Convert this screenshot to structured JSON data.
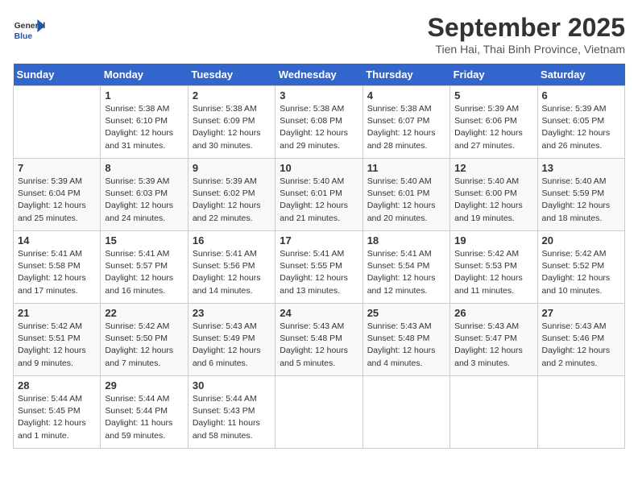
{
  "header": {
    "logo_line1": "General",
    "logo_line2": "Blue",
    "month": "September 2025",
    "location": "Tien Hai, Thai Binh Province, Vietnam"
  },
  "weekdays": [
    "Sunday",
    "Monday",
    "Tuesday",
    "Wednesday",
    "Thursday",
    "Friday",
    "Saturday"
  ],
  "weeks": [
    [
      {
        "day": "",
        "info": ""
      },
      {
        "day": "1",
        "info": "Sunrise: 5:38 AM\nSunset: 6:10 PM\nDaylight: 12 hours\nand 31 minutes."
      },
      {
        "day": "2",
        "info": "Sunrise: 5:38 AM\nSunset: 6:09 PM\nDaylight: 12 hours\nand 30 minutes."
      },
      {
        "day": "3",
        "info": "Sunrise: 5:38 AM\nSunset: 6:08 PM\nDaylight: 12 hours\nand 29 minutes."
      },
      {
        "day": "4",
        "info": "Sunrise: 5:38 AM\nSunset: 6:07 PM\nDaylight: 12 hours\nand 28 minutes."
      },
      {
        "day": "5",
        "info": "Sunrise: 5:39 AM\nSunset: 6:06 PM\nDaylight: 12 hours\nand 27 minutes."
      },
      {
        "day": "6",
        "info": "Sunrise: 5:39 AM\nSunset: 6:05 PM\nDaylight: 12 hours\nand 26 minutes."
      }
    ],
    [
      {
        "day": "7",
        "info": "Sunrise: 5:39 AM\nSunset: 6:04 PM\nDaylight: 12 hours\nand 25 minutes."
      },
      {
        "day": "8",
        "info": "Sunrise: 5:39 AM\nSunset: 6:03 PM\nDaylight: 12 hours\nand 24 minutes."
      },
      {
        "day": "9",
        "info": "Sunrise: 5:39 AM\nSunset: 6:02 PM\nDaylight: 12 hours\nand 22 minutes."
      },
      {
        "day": "10",
        "info": "Sunrise: 5:40 AM\nSunset: 6:01 PM\nDaylight: 12 hours\nand 21 minutes."
      },
      {
        "day": "11",
        "info": "Sunrise: 5:40 AM\nSunset: 6:01 PM\nDaylight: 12 hours\nand 20 minutes."
      },
      {
        "day": "12",
        "info": "Sunrise: 5:40 AM\nSunset: 6:00 PM\nDaylight: 12 hours\nand 19 minutes."
      },
      {
        "day": "13",
        "info": "Sunrise: 5:40 AM\nSunset: 5:59 PM\nDaylight: 12 hours\nand 18 minutes."
      }
    ],
    [
      {
        "day": "14",
        "info": "Sunrise: 5:41 AM\nSunset: 5:58 PM\nDaylight: 12 hours\nand 17 minutes."
      },
      {
        "day": "15",
        "info": "Sunrise: 5:41 AM\nSunset: 5:57 PM\nDaylight: 12 hours\nand 16 minutes."
      },
      {
        "day": "16",
        "info": "Sunrise: 5:41 AM\nSunset: 5:56 PM\nDaylight: 12 hours\nand 14 minutes."
      },
      {
        "day": "17",
        "info": "Sunrise: 5:41 AM\nSunset: 5:55 PM\nDaylight: 12 hours\nand 13 minutes."
      },
      {
        "day": "18",
        "info": "Sunrise: 5:41 AM\nSunset: 5:54 PM\nDaylight: 12 hours\nand 12 minutes."
      },
      {
        "day": "19",
        "info": "Sunrise: 5:42 AM\nSunset: 5:53 PM\nDaylight: 12 hours\nand 11 minutes."
      },
      {
        "day": "20",
        "info": "Sunrise: 5:42 AM\nSunset: 5:52 PM\nDaylight: 12 hours\nand 10 minutes."
      }
    ],
    [
      {
        "day": "21",
        "info": "Sunrise: 5:42 AM\nSunset: 5:51 PM\nDaylight: 12 hours\nand 9 minutes."
      },
      {
        "day": "22",
        "info": "Sunrise: 5:42 AM\nSunset: 5:50 PM\nDaylight: 12 hours\nand 7 minutes."
      },
      {
        "day": "23",
        "info": "Sunrise: 5:43 AM\nSunset: 5:49 PM\nDaylight: 12 hours\nand 6 minutes."
      },
      {
        "day": "24",
        "info": "Sunrise: 5:43 AM\nSunset: 5:48 PM\nDaylight: 12 hours\nand 5 minutes."
      },
      {
        "day": "25",
        "info": "Sunrise: 5:43 AM\nSunset: 5:48 PM\nDaylight: 12 hours\nand 4 minutes."
      },
      {
        "day": "26",
        "info": "Sunrise: 5:43 AM\nSunset: 5:47 PM\nDaylight: 12 hours\nand 3 minutes."
      },
      {
        "day": "27",
        "info": "Sunrise: 5:43 AM\nSunset: 5:46 PM\nDaylight: 12 hours\nand 2 minutes."
      }
    ],
    [
      {
        "day": "28",
        "info": "Sunrise: 5:44 AM\nSunset: 5:45 PM\nDaylight: 12 hours\nand 1 minute."
      },
      {
        "day": "29",
        "info": "Sunrise: 5:44 AM\nSunset: 5:44 PM\nDaylight: 11 hours\nand 59 minutes."
      },
      {
        "day": "30",
        "info": "Sunrise: 5:44 AM\nSunset: 5:43 PM\nDaylight: 11 hours\nand 58 minutes."
      },
      {
        "day": "",
        "info": ""
      },
      {
        "day": "",
        "info": ""
      },
      {
        "day": "",
        "info": ""
      },
      {
        "day": "",
        "info": ""
      }
    ]
  ]
}
